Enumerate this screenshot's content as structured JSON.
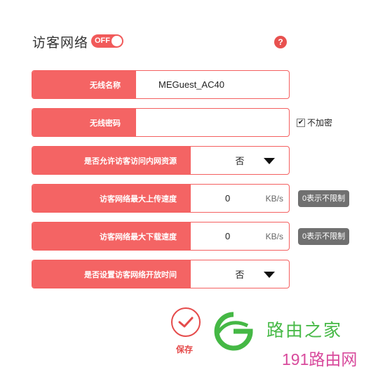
{
  "header": {
    "title": "访客网络",
    "toggle_label": "OFF",
    "help_symbol": "?"
  },
  "form": {
    "ssid": {
      "label": "无线名称",
      "value": "MEGuest_AC40"
    },
    "password": {
      "label": "无线密码",
      "value": "",
      "checkbox_label": "不加密",
      "checkbox_checked": true
    },
    "intranet_access": {
      "label": "是否允许访客访问内网资源",
      "value": "否"
    },
    "upload_speed": {
      "label": "访客网络最大上传速度",
      "value": "0",
      "unit": "KB/s",
      "hint": "0表示不限制"
    },
    "download_speed": {
      "label": "访客网络最大下载速度",
      "value": "0",
      "unit": "KB/s",
      "hint": "0表示不限制"
    },
    "open_time": {
      "label": "是否设置访客网络开放时间",
      "value": "否"
    }
  },
  "save": {
    "label": "保存"
  },
  "watermark": {
    "line1": "路由之家",
    "line2": "191路由网"
  },
  "colors": {
    "accent": "#f46464",
    "badge": "#707070",
    "watermark_green": "#47b947",
    "watermark_pink": "#d84a9c"
  }
}
